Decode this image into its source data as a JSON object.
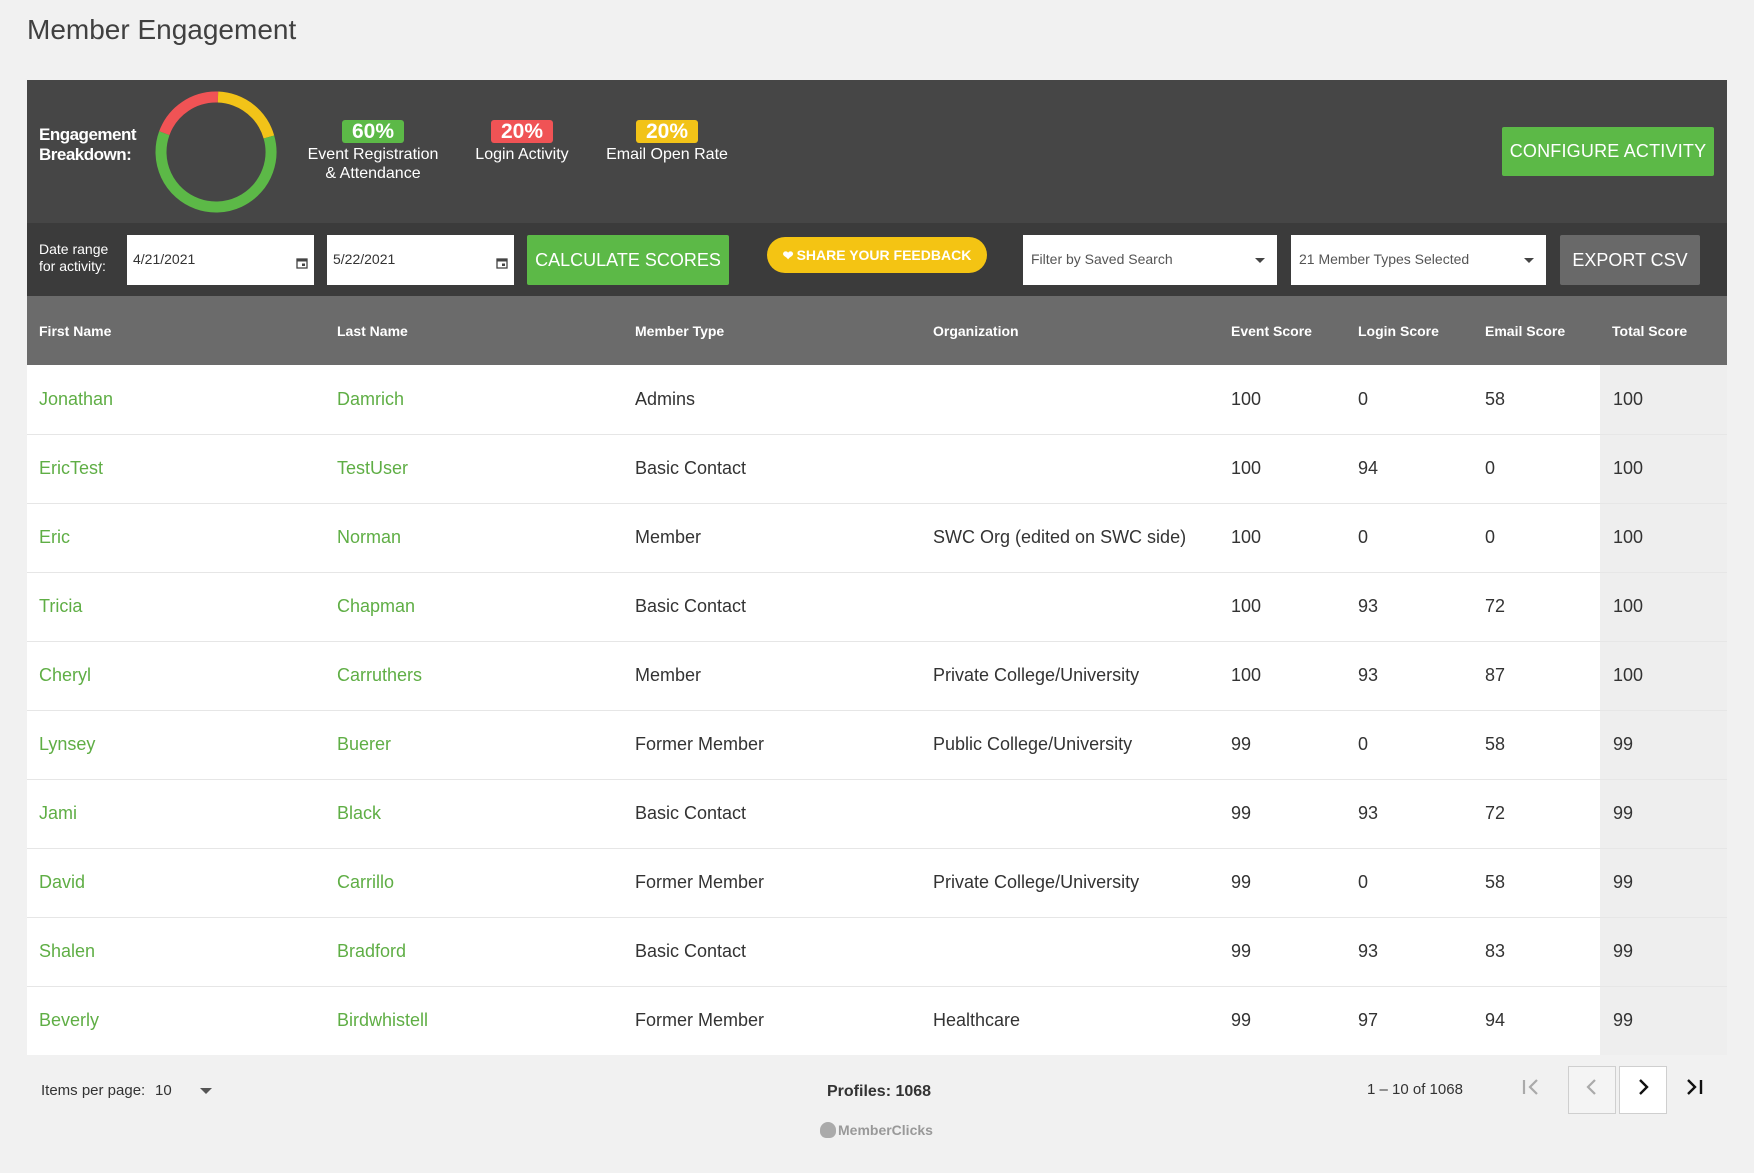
{
  "page": {
    "title": "Member Engagement"
  },
  "engagement": {
    "label_line1": "Engagement",
    "label_line2": "Breakdown:",
    "stats": [
      {
        "pct": "60%",
        "label_line1": "Event Registration",
        "label_line2": "& Attendance",
        "color": "#5cb947",
        "fraction": 0.6
      },
      {
        "pct": "20%",
        "label_line1": "Login Activity",
        "label_line2": "",
        "color": "#f05355",
        "fraction": 0.2
      },
      {
        "pct": "20%",
        "label_line1": "Email Open Rate",
        "label_line2": "",
        "color": "#f2c318",
        "fraction": 0.2
      }
    ],
    "configure_label": "CONFIGURE ACTIVITY"
  },
  "filters": {
    "date_label_line1": "Date range",
    "date_label_line2": "for activity:",
    "start_date": "4/21/2021",
    "end_date": "5/22/2021",
    "calculate_label": "CALCULATE SCORES",
    "feedback_label": "SHARE YOUR FEEDBACK",
    "saved_search_placeholder": "Filter by Saved Search",
    "member_types_value": "21 Member Types Selected",
    "export_label": "EXPORT CSV"
  },
  "table": {
    "columns": [
      "First Name",
      "Last Name",
      "Member Type",
      "Organization",
      "Event Score",
      "Login Score",
      "Email Score",
      "Total Score"
    ],
    "rows": [
      [
        "Jonathan",
        "Damrich",
        "Admins",
        "",
        "100",
        "0",
        "58",
        "100"
      ],
      [
        "EricTest",
        "TestUser",
        "Basic Contact",
        "",
        "100",
        "94",
        "0",
        "100"
      ],
      [
        "Eric",
        "Norman",
        "Member",
        "SWC Org (edited on SWC side)",
        "100",
        "0",
        "0",
        "100"
      ],
      [
        "Tricia",
        "Chapman",
        "Basic Contact",
        "",
        "100",
        "93",
        "72",
        "100"
      ],
      [
        "Cheryl",
        "Carruthers",
        "Member",
        "Private College/University",
        "100",
        "93",
        "87",
        "100"
      ],
      [
        "Lynsey",
        "Buerer",
        "Former Member",
        "Public College/University",
        "99",
        "0",
        "58",
        "99"
      ],
      [
        "Jami",
        "Black",
        "Basic Contact",
        "",
        "99",
        "93",
        "72",
        "99"
      ],
      [
        "David",
        "Carrillo",
        "Former Member",
        "Private College/University",
        "99",
        "0",
        "58",
        "99"
      ],
      [
        "Shalen",
        "Bradford",
        "Basic Contact",
        "",
        "99",
        "93",
        "83",
        "99"
      ],
      [
        "Beverly",
        "Birdwhistell",
        "Former Member",
        "Healthcare",
        "99",
        "97",
        "94",
        "99"
      ]
    ]
  },
  "footer": {
    "items_per_page_label": "Items per page:",
    "items_per_page_value": "10",
    "profiles_label": "Profiles: 1068",
    "range_label": "1 – 10 of 1068",
    "brand": "MemberClicks"
  },
  "icons": {
    "first_page": "first-page-icon",
    "prev_page": "chevron-left-icon",
    "next_page": "chevron-right-icon",
    "last_page": "last-page-icon",
    "calendar": "calendar-icon",
    "heart": "heart-icon"
  }
}
